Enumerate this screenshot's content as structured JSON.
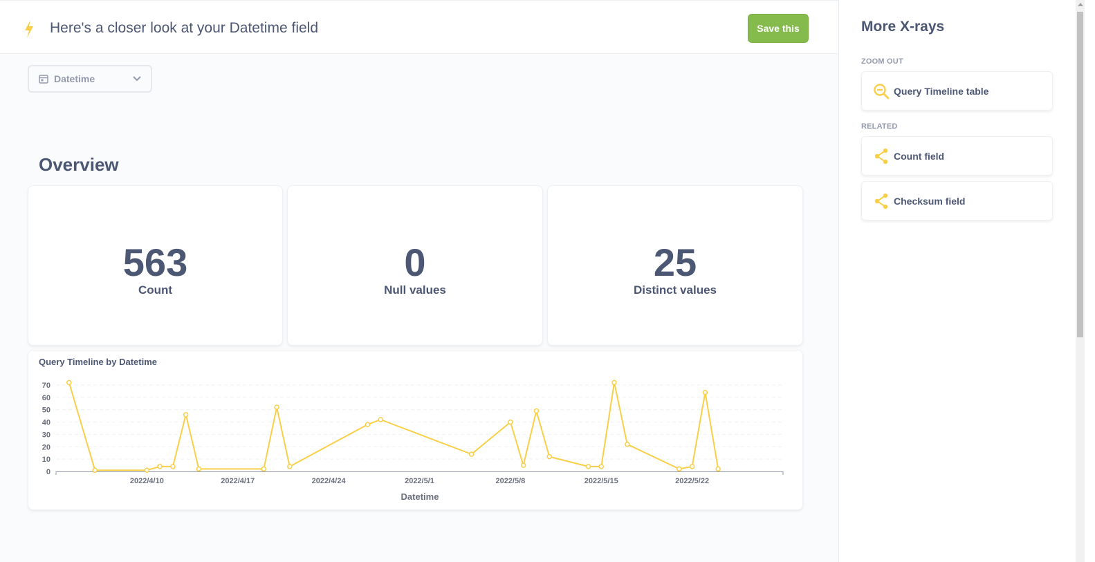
{
  "header": {
    "title": "Here's a closer look at your Datetime field",
    "save_label": "Save this",
    "accent": "#f9cf48",
    "save_color": "#84bb4c"
  },
  "field_selector": {
    "value": "Datetime"
  },
  "overview": {
    "title": "Overview",
    "cards": [
      {
        "value": "563",
        "label": "Count"
      },
      {
        "value": "0",
        "label": "Null values"
      },
      {
        "value": "25",
        "label": "Distinct values"
      }
    ]
  },
  "sidebar": {
    "title": "More X-rays",
    "zoom_out_label": "ZOOM OUT",
    "zoom_out_items": [
      {
        "label": "Query Timeline table",
        "icon": "zoom-out-icon"
      }
    ],
    "related_label": "RELATED",
    "related_items": [
      {
        "label": "Count field",
        "icon": "share-icon"
      },
      {
        "label": "Checksum field",
        "icon": "share-icon"
      }
    ]
  },
  "chart_data": {
    "type": "line",
    "title": "Query Timeline by Datetime",
    "xlabel": "Datetime",
    "ylabel": "",
    "color": "#f9cf48",
    "ylim": [
      0,
      70
    ],
    "yticks": [
      0,
      10,
      20,
      30,
      40,
      50,
      60,
      70
    ],
    "xlim": [
      "2022-04-03",
      "2022-05-29"
    ],
    "xticks": [
      {
        "date": "2022-04-10",
        "label": "2022/4/10"
      },
      {
        "date": "2022-04-17",
        "label": "2022/4/17"
      },
      {
        "date": "2022-04-24",
        "label": "2022/4/24"
      },
      {
        "date": "2022-05-01",
        "label": "2022/5/1"
      },
      {
        "date": "2022-05-08",
        "label": "2022/5/8"
      },
      {
        "date": "2022-05-15",
        "label": "2022/5/15"
      },
      {
        "date": "2022-05-22",
        "label": "2022/5/22"
      }
    ],
    "grid": true,
    "points": [
      {
        "x": "2022-04-04",
        "y": 72
      },
      {
        "x": "2022-04-06",
        "y": 1
      },
      {
        "x": "2022-04-10",
        "y": 1
      },
      {
        "x": "2022-04-11",
        "y": 4
      },
      {
        "x": "2022-04-12",
        "y": 4
      },
      {
        "x": "2022-04-13",
        "y": 46
      },
      {
        "x": "2022-04-14",
        "y": 2
      },
      {
        "x": "2022-04-19",
        "y": 2
      },
      {
        "x": "2022-04-20",
        "y": 52
      },
      {
        "x": "2022-04-21",
        "y": 4
      },
      {
        "x": "2022-04-27",
        "y": 38
      },
      {
        "x": "2022-04-28",
        "y": 42
      },
      {
        "x": "2022-05-05",
        "y": 14
      },
      {
        "x": "2022-05-08",
        "y": 40
      },
      {
        "x": "2022-05-09",
        "y": 5
      },
      {
        "x": "2022-05-10",
        "y": 49
      },
      {
        "x": "2022-05-11",
        "y": 12
      },
      {
        "x": "2022-05-14",
        "y": 4
      },
      {
        "x": "2022-05-15",
        "y": 4
      },
      {
        "x": "2022-05-16",
        "y": 72
      },
      {
        "x": "2022-05-17",
        "y": 22
      },
      {
        "x": "2022-05-21",
        "y": 2
      },
      {
        "x": "2022-05-22",
        "y": 4
      },
      {
        "x": "2022-05-23",
        "y": 64
      },
      {
        "x": "2022-05-24",
        "y": 2
      }
    ]
  }
}
